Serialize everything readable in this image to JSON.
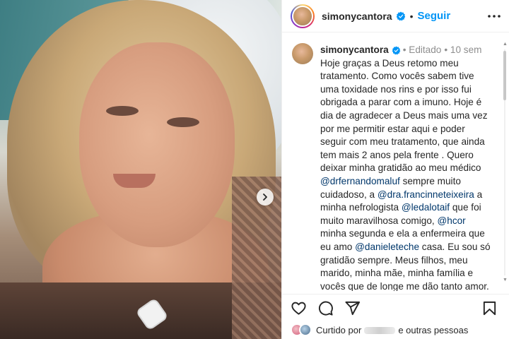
{
  "post": {
    "username": "simonycantora",
    "follow_label": "Seguir",
    "separator": "•",
    "verified_icon": "verified-badge-icon",
    "more_icon": "more-options-icon",
    "accent_color": "#0095f6"
  },
  "caption": {
    "username": "simonycantora",
    "edited_label": "Editado",
    "time_sep": "•",
    "time": "10 sem",
    "parts": {
      "p1": "Hoje graças a Deus retomo meu tratamento. Como vocês sabem tive uma toxidade nos rins e por isso fui obrigada a parar com a imuno. Hoje é dia de agradecer a Deus mais uma vez por me permitir estar aqui e poder seguir com meu tratamento, que ainda tem mais 2 anos pela frente . Quero deixar minha gratidão ao meu médico ",
      "m1": "@drfernandomaluf",
      "p2": " sempre muito cuidadoso, a ",
      "m2": "@dra.francinneteixeira",
      "p3": " a minha nefrologista ",
      "m3": "@ledalotaif",
      "p4": " que foi muito maravilhosa comigo, ",
      "m4": "@hcor",
      "p5": " minha segunda e ela a enfermeira que eu amo ",
      "m5": "@danieleteche",
      "p6": " casa. Eu sou só gratidão sempre. Meus filhos, meu marido, minha mãe, minha família e vocês que de longe me dão tanto amor. Vamos em frente UM DIA DE CADA VEZ"
    }
  },
  "actions": {
    "like_icon": "heart-icon",
    "comment_icon": "comment-icon",
    "share_icon": "share-icon",
    "save_icon": "bookmark-icon"
  },
  "likes": {
    "prefix": "Curtido por",
    "suffix": "e outras pessoas"
  },
  "media": {
    "next_icon": "chevron-right-icon"
  }
}
